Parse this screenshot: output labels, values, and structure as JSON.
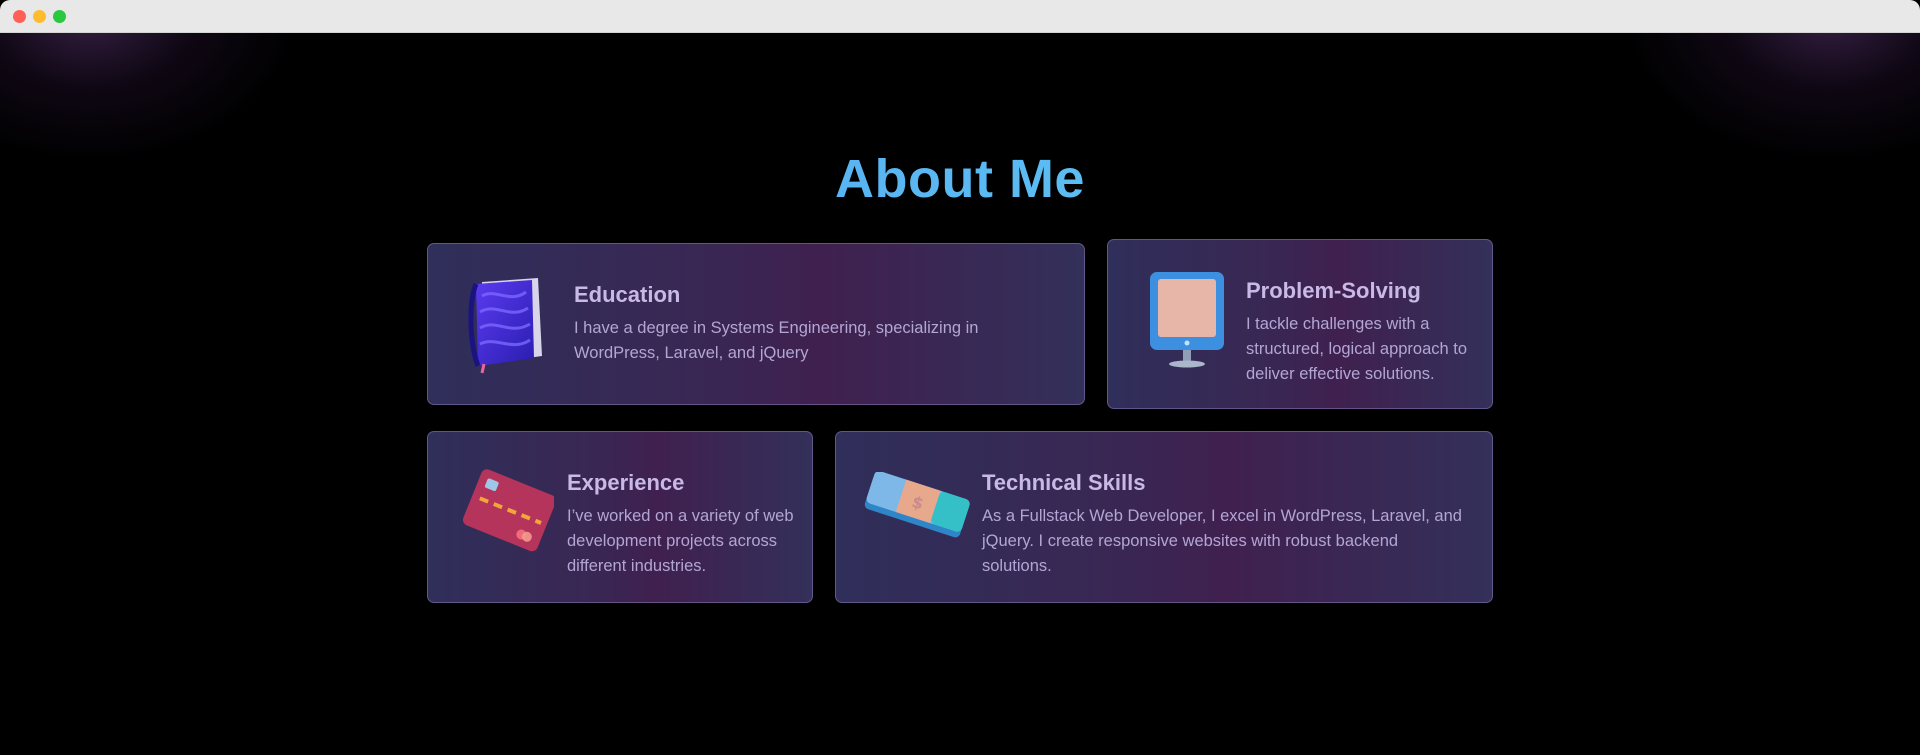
{
  "window": {
    "controls": [
      "close",
      "minimize",
      "maximize"
    ]
  },
  "section": {
    "title": "About Me"
  },
  "cards": {
    "education": {
      "title": "Education",
      "text": "I have a degree in Systems Engineering, specializing in WordPress, Laravel, and jQuery",
      "icon": "book-icon"
    },
    "problem": {
      "title": "Problem-Solving",
      "text": "I tackle challenges with a structured, logical approach to deliver effective solutions.",
      "icon": "monitor-icon"
    },
    "experience": {
      "title": "Experience",
      "text": "I’ve worked on a variety of web development projects across different industries.",
      "icon": "credit-card-icon"
    },
    "skills": {
      "title": "Technical Skills",
      "text": "As a Fullstack Web Developer, I excel in WordPress, Laravel, and jQuery. I create responsive websites with robust backend solutions.",
      "icon": "banknote-icon"
    }
  },
  "colors": {
    "heading_gradient": [
      "#4f9cf0",
      "#6ee0f7"
    ],
    "card_title": "#c9b9e6",
    "card_text": "#b3a6d4"
  }
}
